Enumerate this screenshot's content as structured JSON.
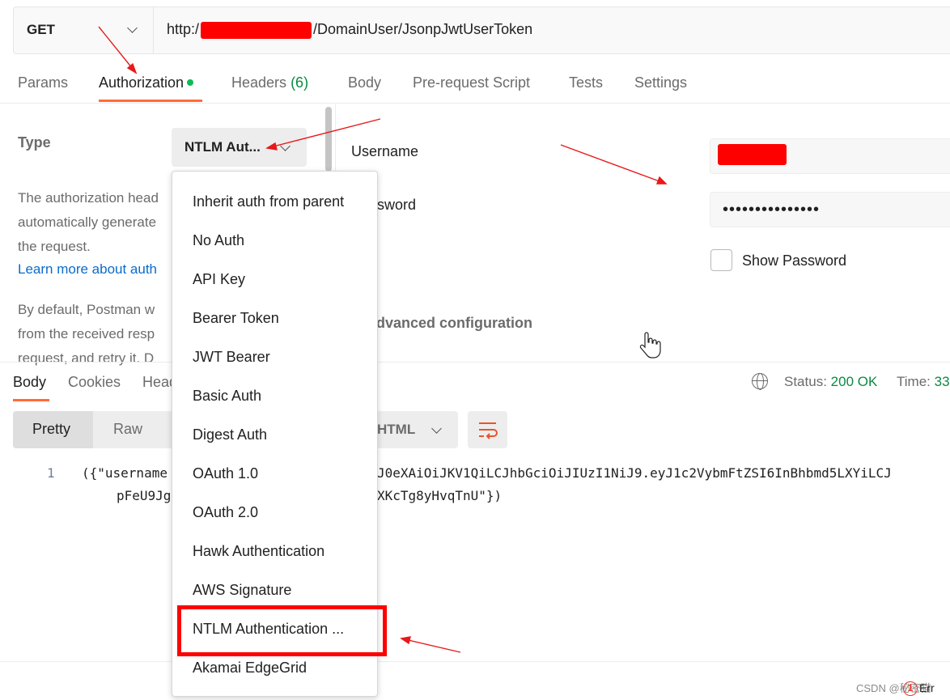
{
  "request": {
    "method": "GET",
    "url_prefix": "http:/",
    "url_suffix": "/DomainUser/JsonpJwtUserToken"
  },
  "tabs": [
    {
      "label": "Params"
    },
    {
      "label": "Authorization"
    },
    {
      "label": "Headers",
      "count": "(6)"
    },
    {
      "label": "Body"
    },
    {
      "label": "Pre-request Script"
    },
    {
      "label": "Tests"
    },
    {
      "label": "Settings"
    }
  ],
  "auth": {
    "type_label": "Type",
    "type_value": "NTLM Aut...",
    "desc_lines": [
      "The authorization head",
      "automatically generate",
      "the request."
    ],
    "learn_more": "Learn more about auth",
    "default_lines": [
      "By default, Postman w",
      "from the received resp",
      "request, and retry it. D"
    ],
    "username_label": "Username",
    "password_label": "Password",
    "password_partial": "sword",
    "password_value": "•••••••••••••••",
    "show_password": "Show Password",
    "advanced": "dvanced configuration"
  },
  "auth_types": [
    "Inherit auth from parent",
    "No Auth",
    "API Key",
    "Bearer Token",
    "JWT Bearer",
    "Basic Auth",
    "Digest Auth",
    "OAuth 1.0",
    "OAuth 2.0",
    "Hawk Authentication",
    "AWS Signature",
    "NTLM Authentication ...",
    "Akamai EdgeGrid"
  ],
  "response": {
    "tabs": [
      {
        "label": "Body"
      },
      {
        "label": "Cookies"
      },
      {
        "label": "Head"
      }
    ],
    "status_label": "Status:",
    "status_value": "200 OK",
    "time_label": "Time:",
    "time_value": "33",
    "view_modes": [
      "Pretty",
      "Raw"
    ],
    "format": "HTML",
    "code": {
      "line_number": "1",
      "line1_left": "({\"username",
      "line1_right": "J0eXAiOiJKV1QiLCJhbGciOiJIUzI1NiJ9.eyJ1c2VybmFtZSI6InBhbmd5LXYiLCJ",
      "line2_left": "pFeU9Jg",
      "line2_right": "XKcTg8yHvqTnU\"})"
    }
  },
  "footer": {
    "watermark": "CSDN @秘密猫",
    "error_count": "1",
    "error_text": "Err"
  },
  "colors": {
    "accent": "#ff6c37",
    "success": "#0a8a3f",
    "link": "#0b6bcb",
    "annotation": "#e8191a"
  }
}
